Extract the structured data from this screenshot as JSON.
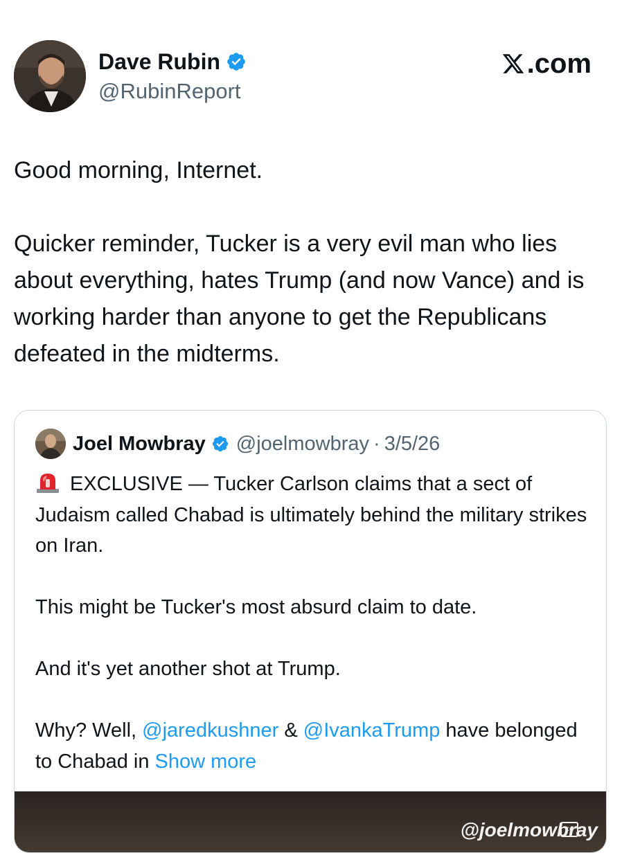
{
  "author": {
    "display_name": "Dave Rubin",
    "handle": "@RubinReport",
    "verified": true
  },
  "source_label": ".com",
  "tweet": {
    "paragraphs": [
      "Good morning, Internet.",
      "Quicker reminder, Tucker is a very evil man who lies about everything, hates Trump (and now Vance) and is working harder than anyone to get the Republicans defeated in the midterms."
    ]
  },
  "quoted_tweet": {
    "display_name": "Joel Mowbray",
    "handle": "@joelmowbray",
    "separator": "·",
    "date": "3/5/26",
    "icon": "siren-emoji",
    "paragraph_1": "EXCLUSIVE — Tucker Carlson claims that a sect of Judaism called Chabad is ultimately behind the military strikes on Iran.",
    "paragraph_2": "This might be Tucker's most absurd claim to date.",
    "paragraph_3": "And it's yet another shot at Trump.",
    "paragraph_4_prefix": "Why? Well, ",
    "mention_1": "@jaredkushner",
    "connector": " & ",
    "mention_2": "@IvankaTrump",
    "paragraph_4_suffix": " have belonged to Chabad in ",
    "show_more": "Show more",
    "media_watermark": "@joelmowbray",
    "cc_label": "cc"
  },
  "colors": {
    "text": "#0f1419",
    "secondary": "#536471",
    "link": "#1d9bf0",
    "border": "#cfd9de"
  }
}
